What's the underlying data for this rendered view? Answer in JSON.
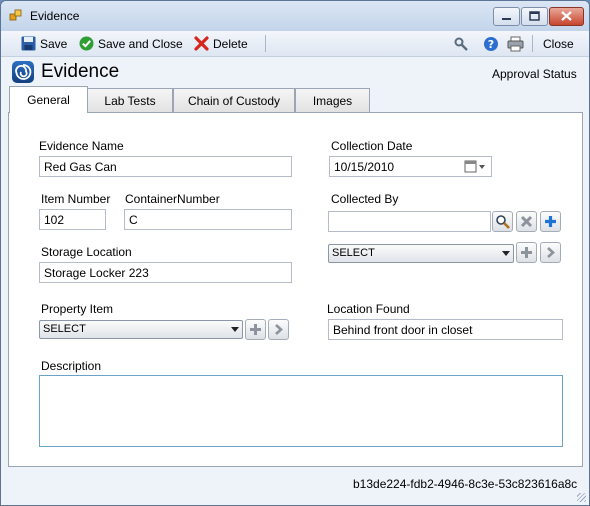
{
  "window": {
    "title": "Evidence"
  },
  "toolbar": {
    "save": "Save",
    "save_close": "Save and Close",
    "delete": "Delete",
    "close": "Close"
  },
  "header": {
    "title": "Evidence",
    "approval_status": "Approval Status"
  },
  "tabs": [
    {
      "label": "General",
      "active": true
    },
    {
      "label": "Lab Tests"
    },
    {
      "label": "Chain of Custody"
    },
    {
      "label": "Images"
    }
  ],
  "form": {
    "evidence_name_label": "Evidence Name",
    "evidence_name": "Red Gas Can",
    "collection_date_label": "Collection Date",
    "collection_date": "10/15/2010",
    "item_number_label": "Item Number",
    "item_number": "102",
    "container_number_label": "ContainerNumber",
    "container_number": "C",
    "collected_by_label": "Collected By",
    "collected_by": "",
    "collected_by_select": "SELECT",
    "storage_location_label": "Storage Location",
    "storage_location": "Storage Locker 223",
    "property_item_label": "Property Item",
    "property_item_select": "SELECT",
    "location_found_label": "Location Found",
    "location_found": "Behind front door in closet",
    "description_label": "Description",
    "description": ""
  },
  "footer": {
    "guid": "b13de224-fdb2-4946-8c3e-53c823616a8c"
  },
  "colors": {
    "accent": "#2e6fc2",
    "close_red": "#c7442d",
    "add_blue": "#1e73d6"
  }
}
